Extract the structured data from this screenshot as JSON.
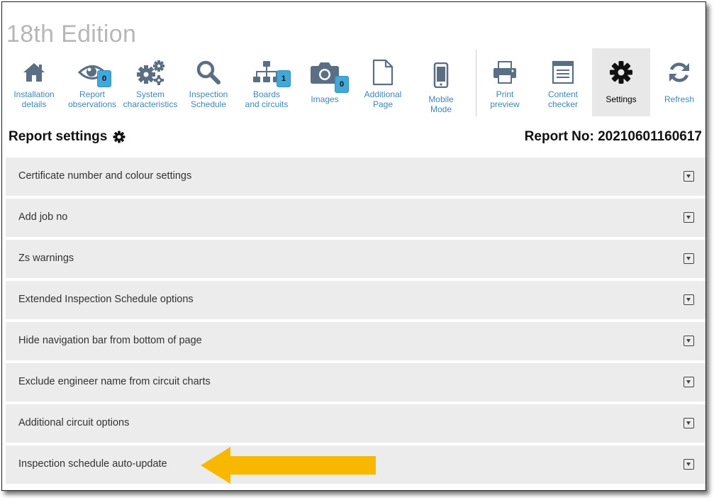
{
  "app": {
    "edition": "18th Edition"
  },
  "toolbar": {
    "items": [
      {
        "label": "Installation\ndetails",
        "icon": "home-icon"
      },
      {
        "label": "Report\nobservations",
        "icon": "eye-icon",
        "badge": "0"
      },
      {
        "label": "System\ncharacteristics",
        "icon": "cogs-icon"
      },
      {
        "label": "Inspection\nSchedule",
        "icon": "search-icon"
      },
      {
        "label": "Boards\nand circuits",
        "icon": "sitemap-icon",
        "badge": "1"
      },
      {
        "label": "Images",
        "icon": "camera-icon",
        "badge": "0"
      },
      {
        "label": "Additional\nPage",
        "icon": "file-icon"
      },
      {
        "label": "Mobile\nMode",
        "icon": "mobile-icon"
      },
      {
        "label": "Print\npreview",
        "icon": "print-icon"
      },
      {
        "label": "Content\nchecker",
        "icon": "checklist-icon"
      },
      {
        "label": "Settings",
        "icon": "gear-icon",
        "active": true
      },
      {
        "label": "Refresh",
        "icon": "refresh-icon"
      }
    ]
  },
  "page": {
    "title": "Report settings",
    "report_no": "Report No: 20210601160617"
  },
  "settings": [
    "Certificate number and colour settings",
    "Add job no",
    "Zs warnings",
    "Extended Inspection Schedule options",
    "Hide navigation bar from bottom of page",
    "Exclude engineer name from circuit charts",
    "Additional circuit options",
    "Inspection schedule auto-update"
  ],
  "colors": {
    "toolbar_icon": "#5a6f84",
    "label_link": "#3f86b8",
    "badge": "#43a8d7",
    "row_bg": "#ececec",
    "arrow": "#f9b800"
  }
}
